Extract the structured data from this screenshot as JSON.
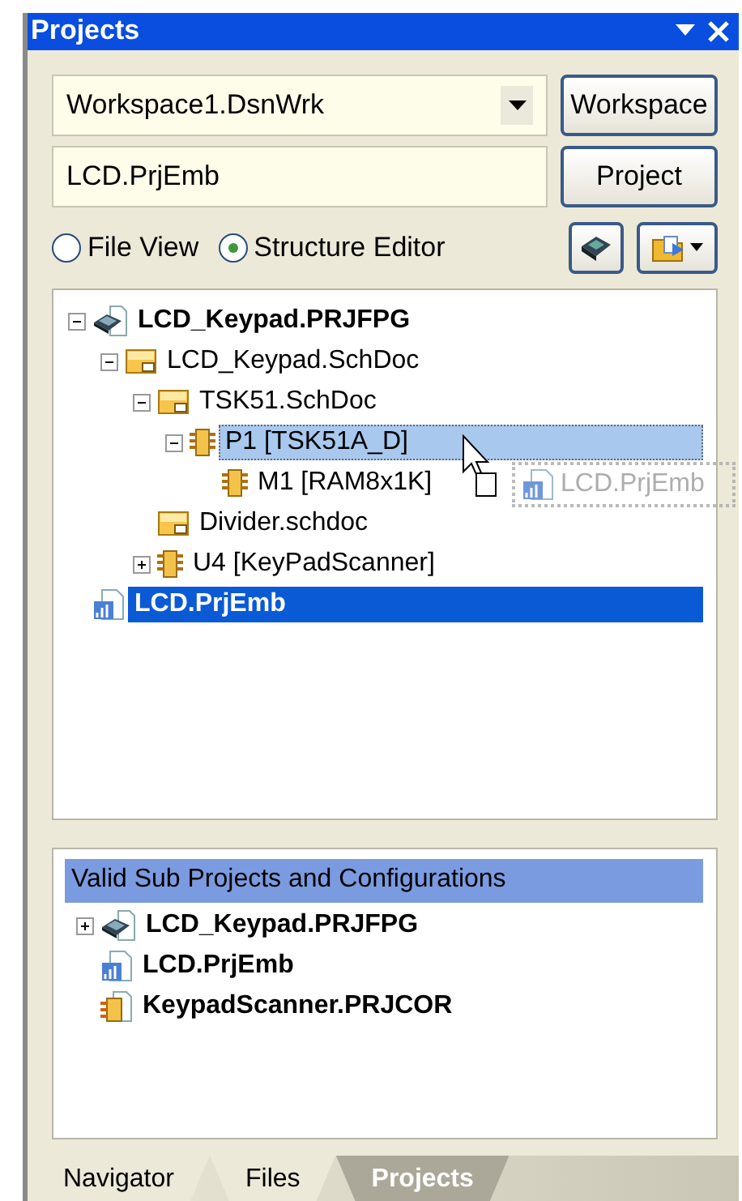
{
  "panel": {
    "title": "Projects"
  },
  "workspace": {
    "value": "Workspace1.DsnWrk",
    "button": "Workspace"
  },
  "project": {
    "value": "LCD.PrjEmb",
    "button": "Project"
  },
  "view_options": [
    {
      "label": "File View",
      "selected": false
    },
    {
      "label": "Structure Editor",
      "selected": true
    }
  ],
  "tree": [
    {
      "label": "LCD_Keypad.PRJFPG",
      "kind": "fpga-project",
      "expanded": true,
      "selected": false,
      "drop_target": false,
      "children": [
        {
          "label": "LCD_Keypad.SchDoc",
          "kind": "schematic",
          "expanded": true,
          "selected": false,
          "drop_target": false,
          "children": [
            {
              "label": "TSK51.SchDoc",
              "kind": "schematic",
              "expanded": true,
              "selected": false,
              "drop_target": false,
              "children": [
                {
                  "label": "P1 [TSK51A_D]",
                  "kind": "chip",
                  "expanded": true,
                  "selected": false,
                  "drop_target": true,
                  "children": [
                    {
                      "label": "M1 [RAM8x1K]",
                      "kind": "chip",
                      "selected": false,
                      "drop_target": false
                    }
                  ]
                }
              ]
            },
            {
              "label": "Divider.schdoc",
              "kind": "schematic",
              "selected": false,
              "drop_target": false
            },
            {
              "label": "U4 [KeyPadScanner]",
              "kind": "chip",
              "expanded": false,
              "selected": false,
              "drop_target": false
            }
          ]
        }
      ]
    },
    {
      "label": "LCD.PrjEmb",
      "kind": "embedded-project",
      "selected": true,
      "drop_target": false
    }
  ],
  "drag_ghost": {
    "label": "LCD.PrjEmb"
  },
  "sub_projects": {
    "header": "Valid Sub Projects and Configurations",
    "items": [
      {
        "label": "LCD_Keypad.PRJFPG",
        "kind": "fpga-project",
        "expanded": false
      },
      {
        "label": "LCD.PrjEmb",
        "kind": "embedded-project"
      },
      {
        "label": "KeypadScanner.PRJCOR",
        "kind": "core-project"
      }
    ]
  },
  "tabs": [
    {
      "label": "Navigator",
      "selected": false
    },
    {
      "label": "Files",
      "selected": false
    },
    {
      "label": "Projects",
      "selected": true
    }
  ]
}
